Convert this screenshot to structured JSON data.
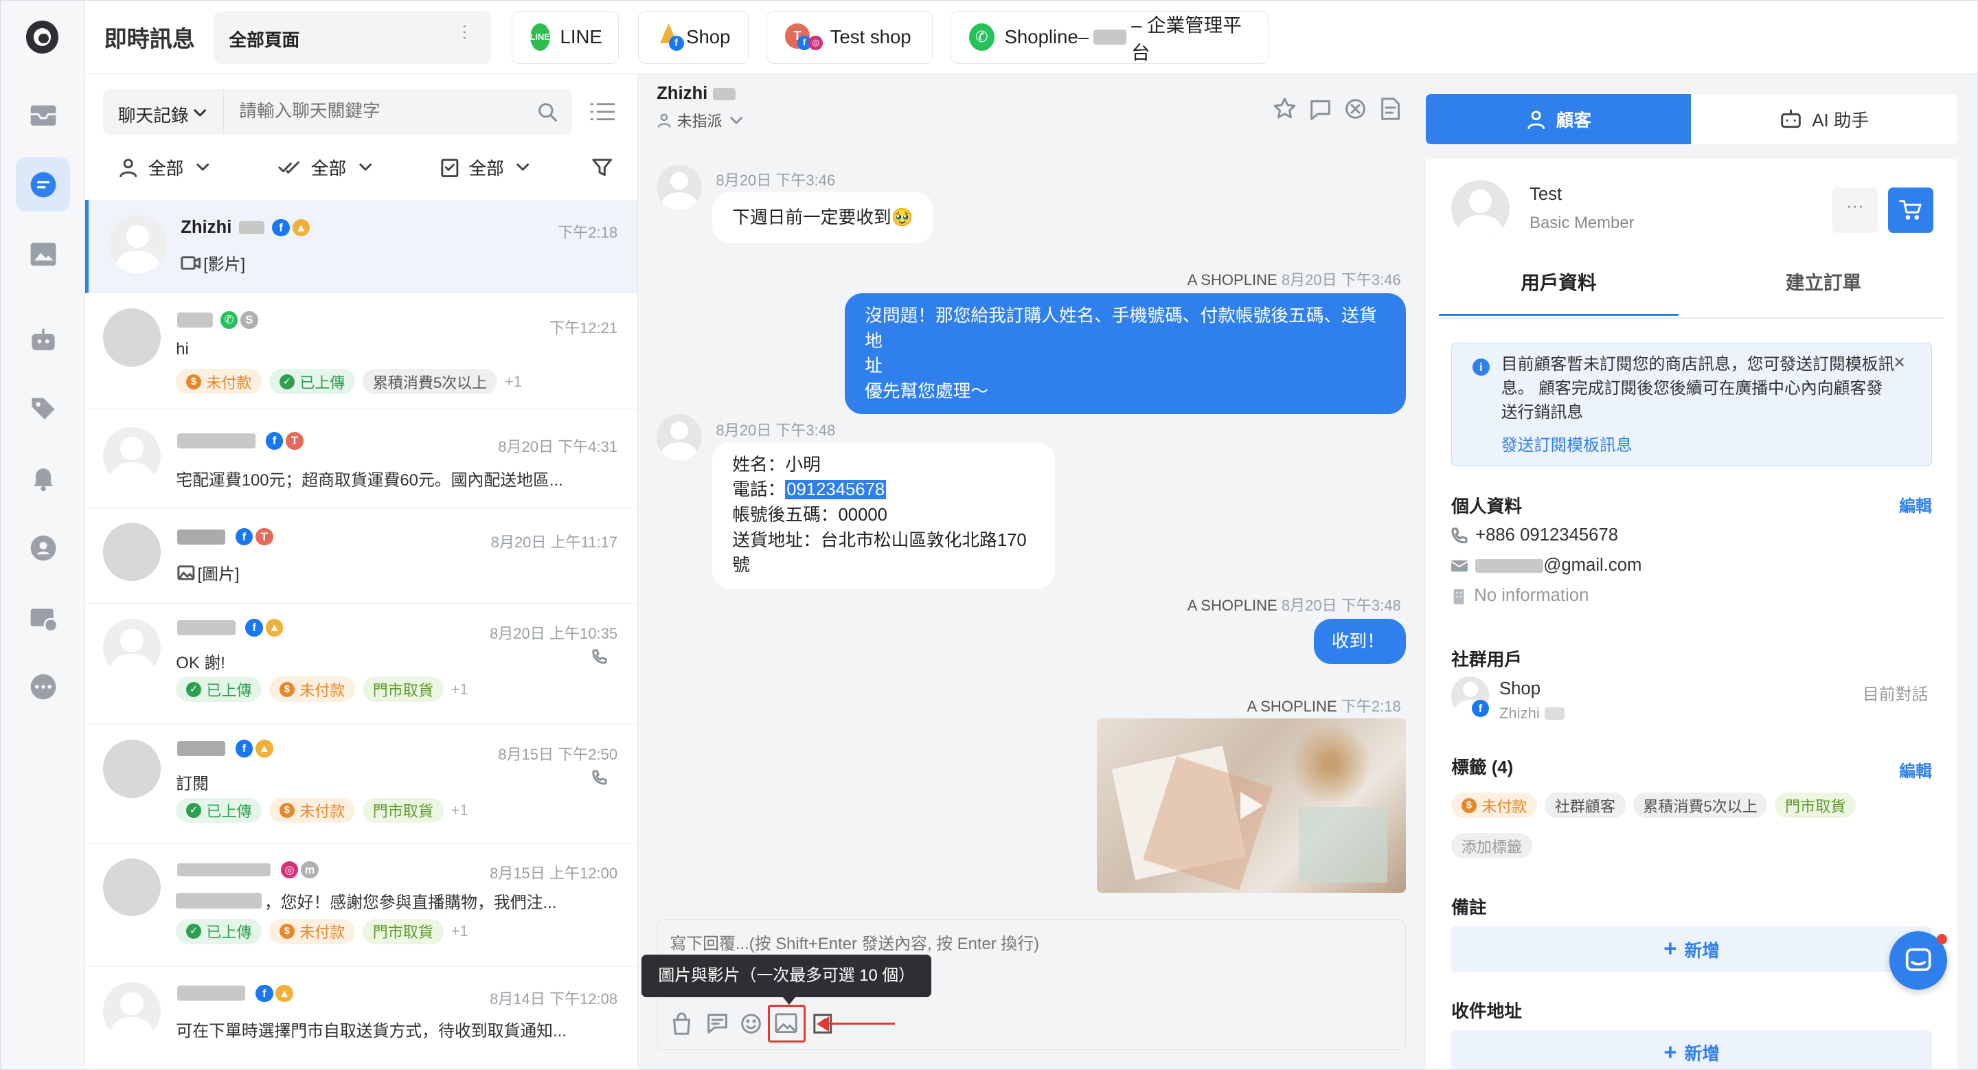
{
  "topbar": {
    "title": "即時訊息",
    "page_select": "全部頁面",
    "tabs": [
      {
        "label": "LINE"
      },
      {
        "label": "Shop"
      },
      {
        "label": "Test shop"
      },
      {
        "label": "Shopline–",
        "suffix": "– 企業管理平台"
      }
    ]
  },
  "list": {
    "search_scope": "聊天記錄",
    "search_placeholder": "請輸入聊天關鍵字",
    "filters": [
      "全部",
      "全部",
      "全部"
    ],
    "conversations": [
      {
        "name": "Zhizhi",
        "time": "下午2:18",
        "preview": "[影片]"
      },
      {
        "name": "",
        "time": "下午12:21",
        "preview": "hi",
        "tags": [
          "未付款",
          "已上傳",
          "累積消費5次以上"
        ],
        "more": "+1"
      },
      {
        "name": "",
        "time": "8月20日 下午4:31",
        "preview": "宅配運費100元；超商取貨運費60元。國內配送地區..."
      },
      {
        "name": "",
        "time": "8月20日 上午11:17",
        "preview": "[圖片]"
      },
      {
        "name": "",
        "time": "8月20日 上午10:35",
        "preview": "OK 謝!",
        "tags": [
          "已上傳",
          "未付款",
          "門市取貨"
        ],
        "more": "+1"
      },
      {
        "name": "",
        "time": "8月15日 下午2:50",
        "preview": "訂閱",
        "tags": [
          "已上傳",
          "未付款",
          "門市取貨"
        ],
        "more": "+1"
      },
      {
        "name": "",
        "time": "8月15日 上午12:00",
        "preview": "，您好！感謝您參與直播購物，我們注...",
        "tags": [
          "已上傳",
          "未付款",
          "門市取貨"
        ],
        "more": "+1"
      },
      {
        "name": "",
        "time": "8月14日 下午12:08",
        "preview": "可在下單時選擇門市自取送貨方式，待收到取貨通知..."
      }
    ]
  },
  "chat": {
    "contact": "Zhizhi",
    "assign": "未指派",
    "messages": [
      {
        "meta": "8月20日 下午3:46",
        "text": "下週日前一定要收到🥹"
      },
      {
        "meta_sender": "A SHOPLINE",
        "meta": "8月20日 下午3:46",
        "line1": "沒問題！那您給我訂購人姓名、手機號碼、付款帳號後五碼、送貨地",
        "line2": "址",
        "line3": "優先幫您處理～"
      },
      {
        "meta": "8月20日 下午3:48",
        "name": "姓名：小明",
        "phone_label": "電話：",
        "phone": "0912345678",
        "account": "帳號後五碼：00000",
        "address": "送貨地址：台北市松山區敦化北路170號"
      },
      {
        "meta_sender": "A SHOPLINE",
        "meta": "8月20日 下午3:48",
        "text": "收到！"
      },
      {
        "meta_sender": "A SHOPLINE",
        "meta": "下午2:18"
      }
    ],
    "input_placeholder": "寫下回覆...(按 Shift+Enter 發送內容, 按 Enter 換行)",
    "tooltip": "圖片與影片（一次最多可選 10 個）"
  },
  "customer": {
    "tab_customer": "顧客",
    "tab_ai": "AI 助手",
    "name": "Test",
    "level": "Basic Member",
    "subtab_profile": "用戶資料",
    "subtab_order": "建立訂單",
    "notice": "目前顧客暫未訂閱您的商店訊息，您可發送訂閱模板訊息。 顧客完成訂閱後您後續可在廣播中心內向顧客發送行銷訊息",
    "notice_link": "發送訂閱模板訊息",
    "personal_title": "個人資料",
    "edit": "編輯",
    "phone": "+886 0912345678",
    "email": "@gmail.com",
    "no_info": "No information",
    "social_title": "社群用戶",
    "social_name": "Shop",
    "social_sub": "Zhizhi",
    "social_status": "目前對話",
    "tags_title": "標籤 (4)",
    "tags": [
      "未付款",
      "社群顧客",
      "累積消費5次以上",
      "門市取貨"
    ],
    "add_tag": "添加標籤",
    "notes_title": "備註",
    "add_label": "新增",
    "address_title": "收件地址",
    "address_add": "新增"
  }
}
